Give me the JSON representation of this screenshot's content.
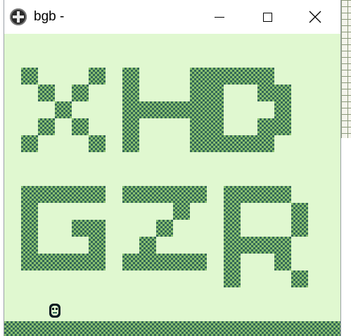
{
  "window": {
    "title": "bgb -"
  },
  "icons": {
    "app": "dpad-icon",
    "minimize": "minimize-icon",
    "maximize": "maximize-icon",
    "close": "close-icon"
  },
  "game": {
    "screen_color": "#e0f8d0",
    "palette": [
      "#e0f8d0",
      "#88c070",
      "#346856",
      "#081820"
    ],
    "text_rows": [
      "XHD",
      "GZR"
    ],
    "sprite": "player-face"
  }
}
